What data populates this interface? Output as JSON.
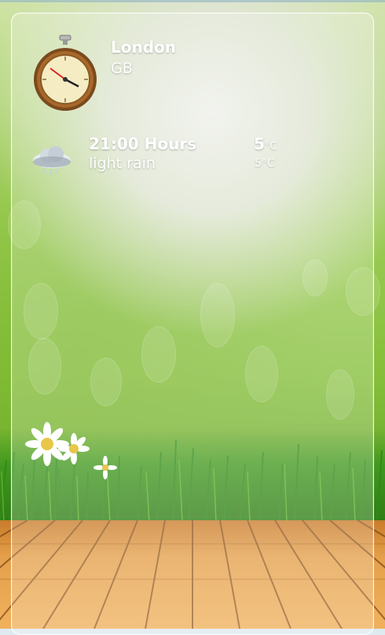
{
  "location": {
    "city": "London",
    "country": "GB"
  },
  "forecast": {
    "time_label": "21:00 Hours",
    "condition": "light rain",
    "temp_high_value": "5",
    "temp_high_unit": "°C",
    "temp_low": "5°C",
    "icon": "rain-cloud-icon"
  },
  "header_icon": "stopwatch-clock-icon",
  "colors": {
    "panel_border": "#ffffff",
    "grass": "#3c8a1c",
    "floor": "#e5a04b"
  }
}
